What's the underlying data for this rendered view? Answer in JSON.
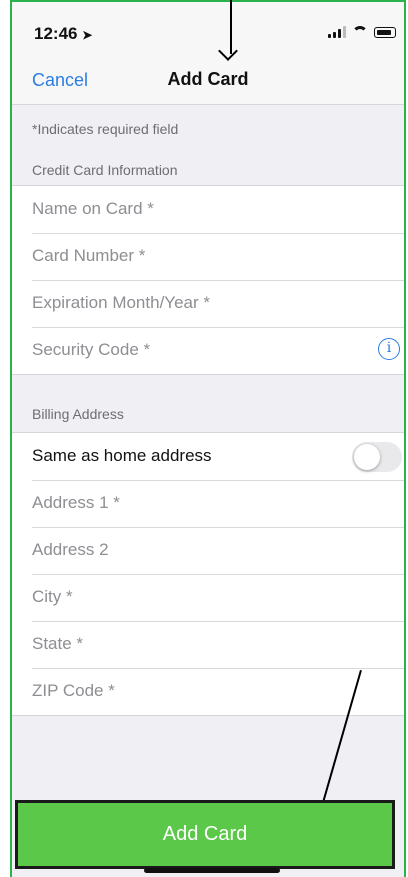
{
  "status": {
    "time": "12:46"
  },
  "nav": {
    "cancel_label": "Cancel",
    "title": "Add Card"
  },
  "sections": {
    "required_note": "*Indicates required field",
    "credit_header": "Credit Card Information",
    "billing_header": "Billing Address"
  },
  "credit_fields": [
    "Name on Card *",
    "Card Number *",
    "Expiration Month/Year *",
    "Security Code *"
  ],
  "billing": {
    "same_as_home_label": "Same as home address",
    "same_as_home_on": false,
    "fields": [
      "Address 1 *",
      "Address 2",
      "City *",
      "State *",
      "ZIP Code *"
    ]
  },
  "footer": {
    "add_button_label": "Add Card"
  },
  "icons": {
    "info": "info-icon",
    "location": "location-arrow-icon"
  },
  "colors": {
    "accent": "#2b7de1",
    "button": "#5bc84a",
    "frame": "#2bb24a"
  }
}
